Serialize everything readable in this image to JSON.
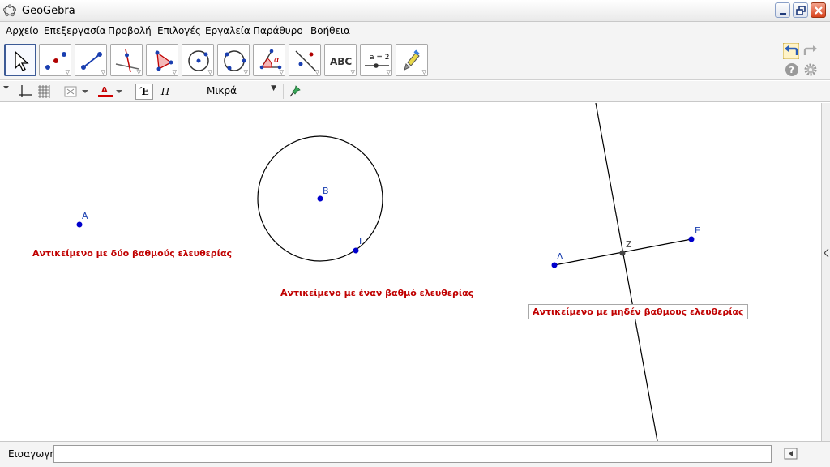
{
  "window": {
    "title": "GeoGebra"
  },
  "menu": [
    "Αρχείο",
    "Επεξεργασία",
    "Προβολή",
    "Επιλογές",
    "Εργαλεία",
    "Παράθυρο",
    "Βοήθεια"
  ],
  "toolbar": {
    "tools": [
      "move-tool",
      "point-tool",
      "segment-tool",
      "perpendicular-line-tool",
      "polygon-tool",
      "circle-center-point-tool",
      "circle-three-points-tool",
      "angle-tool",
      "reflect-tool",
      "text-tool",
      "slider-tool",
      "move-graphics-view-tool"
    ],
    "text_tool_label": "ABC",
    "slider_label": "a = 2"
  },
  "stylebar": {
    "font_label": "Έ",
    "italic_label": "Π",
    "size_value": "Μικρά",
    "color_letter": "A"
  },
  "canvas": {
    "labels": {
      "A": "A",
      "B": "B",
      "C": "Γ",
      "D": "Δ",
      "E": "E",
      "Z": "Z"
    },
    "captions": {
      "two_dof": "Αντικείμενο με δύο βαθμούς ελευθερίας",
      "one_dof": "Αντικείμενο με έναν βαθμό ελευθερίας",
      "zero_dof": "Αντικείμενο με μηδέν βαθμους ελευθερίας"
    },
    "colors": {
      "point": "#0000cc",
      "caption": "#c00000",
      "line": "#000000",
      "intersection": "#444444"
    }
  },
  "inputbar": {
    "label": "Εισαγωγή:",
    "value": ""
  }
}
